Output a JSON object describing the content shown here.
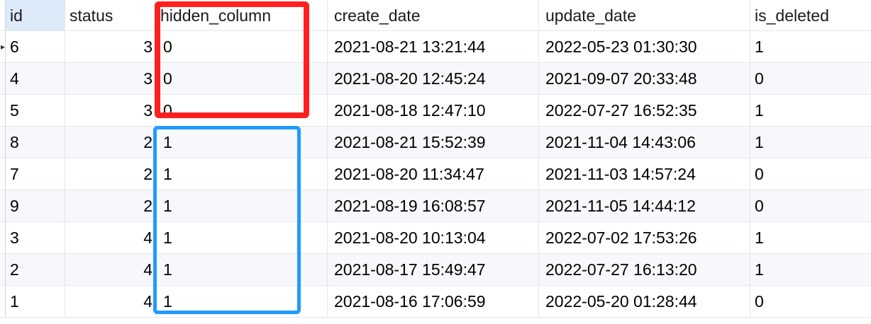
{
  "columns": {
    "id": "id",
    "status": "status",
    "hidden_column": "hidden_column",
    "create_date": "create_date",
    "update_date": "update_date",
    "is_deleted": "is_deleted"
  },
  "current_row_marker": "▸",
  "rows": [
    {
      "id": "6",
      "status": "3",
      "hidden_column": "0",
      "create_date": "2021-08-21 13:21:44",
      "update_date": "2022-05-23 01:30:30",
      "is_deleted": "1"
    },
    {
      "id": "4",
      "status": "3",
      "hidden_column": "0",
      "create_date": "2021-08-20 12:45:24",
      "update_date": "2021-09-07 20:33:48",
      "is_deleted": "0"
    },
    {
      "id": "5",
      "status": "3",
      "hidden_column": "0",
      "create_date": "2021-08-18 12:47:10",
      "update_date": "2022-07-27 16:52:35",
      "is_deleted": "1"
    },
    {
      "id": "8",
      "status": "2",
      "hidden_column": "1",
      "create_date": "2021-08-21 15:52:39",
      "update_date": "2021-11-04 14:43:06",
      "is_deleted": "1"
    },
    {
      "id": "7",
      "status": "2",
      "hidden_column": "1",
      "create_date": "2021-08-20 11:34:47",
      "update_date": "2021-11-03 14:57:24",
      "is_deleted": "0"
    },
    {
      "id": "9",
      "status": "2",
      "hidden_column": "1",
      "create_date": "2021-08-19 16:08:57",
      "update_date": "2021-11-05 14:44:12",
      "is_deleted": "0"
    },
    {
      "id": "3",
      "status": "4",
      "hidden_column": "1",
      "create_date": "2021-08-20 10:13:04",
      "update_date": "2022-07-02 17:53:26",
      "is_deleted": "1"
    },
    {
      "id": "2",
      "status": "4",
      "hidden_column": "1",
      "create_date": "2021-08-17 15:49:47",
      "update_date": "2022-07-27 16:13:20",
      "is_deleted": "1"
    },
    {
      "id": "1",
      "status": "4",
      "hidden_column": "1",
      "create_date": "2021-08-16 17:06:59",
      "update_date": "2022-05-20 01:28:44",
      "is_deleted": "0"
    }
  ],
  "highlight_colors": {
    "group_hidden_0": "#ff1f1f",
    "group_hidden_1": "#1e9bff"
  }
}
